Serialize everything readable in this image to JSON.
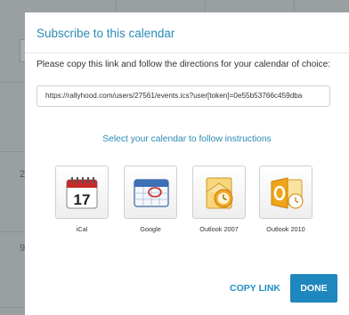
{
  "background": {
    "row_numbers": [
      "2",
      "9"
    ]
  },
  "modal": {
    "title": "Subscribe to this calendar",
    "instructions": "Please copy this link and follow the directions for your calendar of choice:",
    "link": "https://rallyhood.com/users/27561/events.ics?user[token]=0e55b53766c459dba",
    "select_label": "Select your calendar to follow instructions",
    "options": [
      {
        "label": "iCal",
        "icon": "ical-icon"
      },
      {
        "label": "Google",
        "icon": "google-calendar-icon"
      },
      {
        "label": "Outlook 2007",
        "icon": "outlook-2007-icon"
      },
      {
        "label": "Outlook 2010",
        "icon": "outlook-2010-icon"
      }
    ],
    "copy_link_label": "COPY LINK",
    "done_label": "DONE",
    "ical_day": "17"
  },
  "colors": {
    "accent": "#2a8ab4",
    "button": "#1e87bd"
  }
}
